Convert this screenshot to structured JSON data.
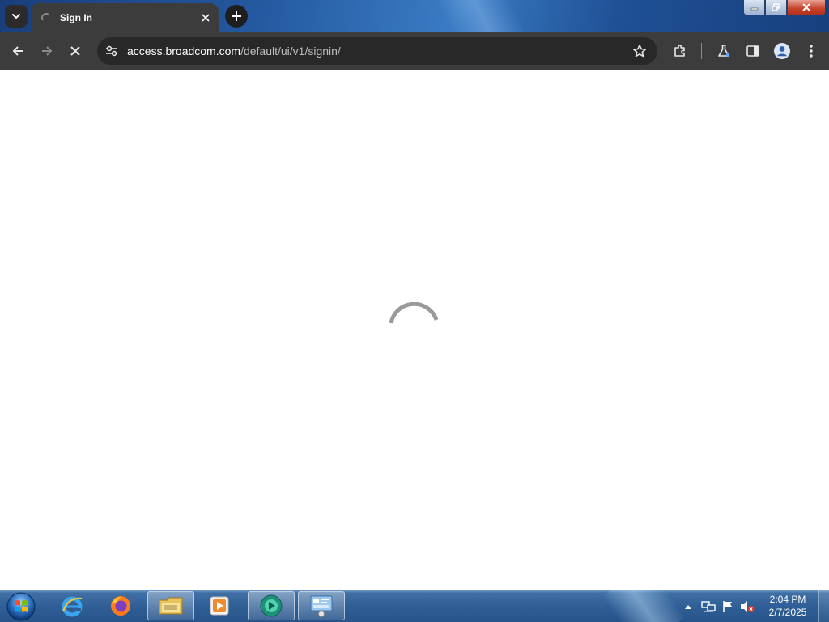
{
  "browser": {
    "tab": {
      "title": "Sign In"
    },
    "address_bar": {
      "host": "access.broadcom.com",
      "path": "/default/ui/v1/signin/"
    },
    "page_state": "loading"
  },
  "window_controls": [
    "minimize",
    "maximize",
    "close"
  ],
  "taskbar": {
    "pinned_apps": [
      "start-orb",
      "internet-explorer",
      "firefox",
      "file-explorer",
      "media-player",
      "app-green-circle",
      "control-panel"
    ],
    "active_apps": [
      "file-explorer",
      "app-green-circle",
      "control-panel"
    ],
    "clock": {
      "time": "2:04 PM",
      "date": "2/7/2025"
    }
  },
  "colors": {
    "tab_bg": "#3c3c3c",
    "toolbar_bg": "#3c3c3c",
    "omnibox_bg": "#282828",
    "spinner": "#9a9a9a"
  }
}
